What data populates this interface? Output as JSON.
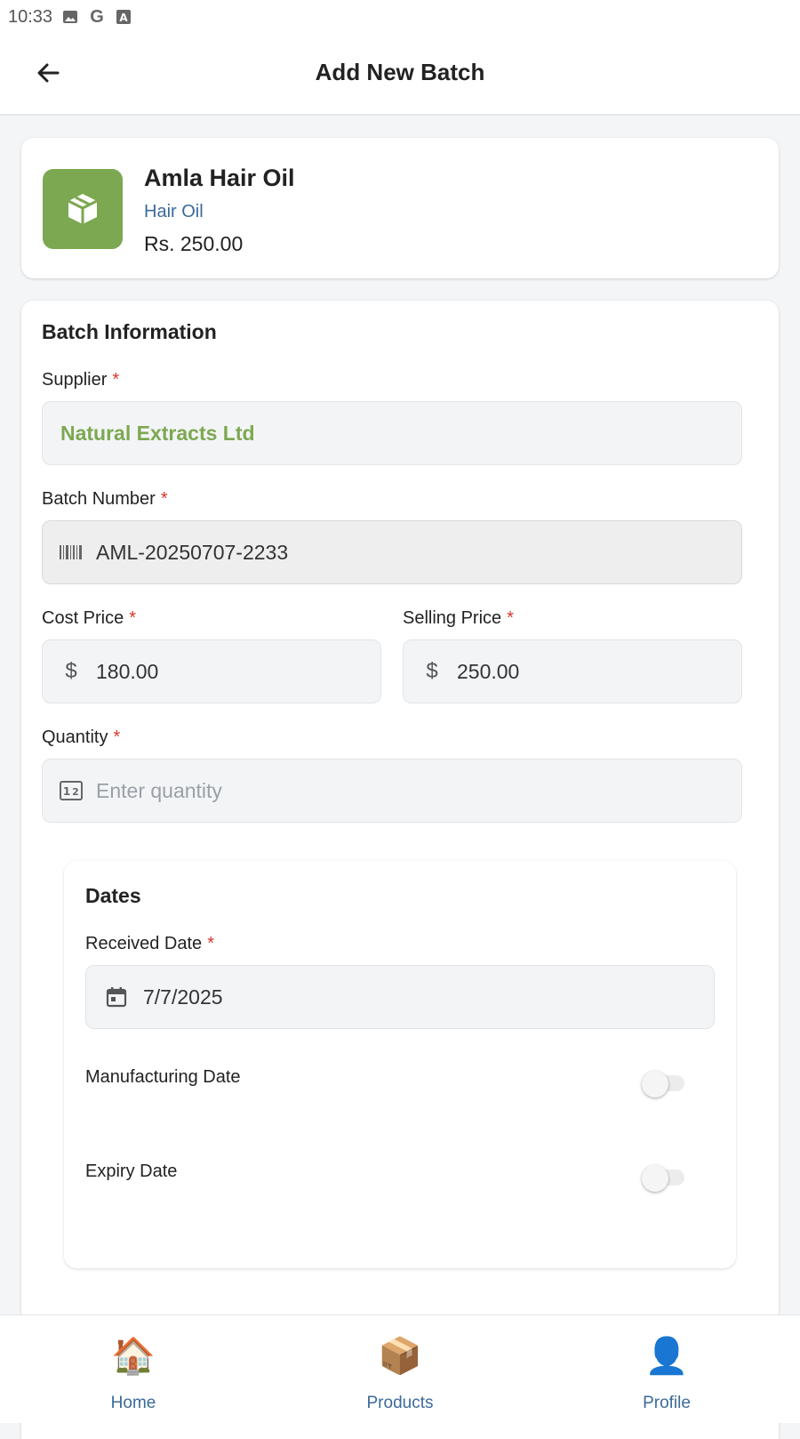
{
  "status_bar": {
    "time": "10:33",
    "icons": [
      "image-icon",
      "google-icon",
      "font-icon"
    ]
  },
  "app_bar": {
    "title": "Add New Batch",
    "back_icon": "arrow-back-icon"
  },
  "product": {
    "name": "Amla Hair Oil",
    "category": "Hair Oil",
    "price": "Rs. 250.00",
    "icon": "box-icon",
    "icon_bg": "#7ca851"
  },
  "batch_info": {
    "title": "Batch Information",
    "supplier": {
      "label": "Supplier",
      "required": "*",
      "value": "Natural Extracts Ltd"
    },
    "batch_number": {
      "label": "Batch Number",
      "required": "*",
      "value": "AML-20250707-2233",
      "icon": "barcode-icon"
    },
    "cost_price": {
      "label": "Cost Price",
      "required": "*",
      "value": "180.00",
      "icon": "dollar-icon"
    },
    "selling_price": {
      "label": "Selling Price",
      "required": "*",
      "value": "250.00",
      "icon": "dollar-icon"
    },
    "quantity": {
      "label": "Quantity",
      "required": "*",
      "placeholder": "Enter quantity",
      "value": "",
      "icon": "numbers-icon"
    }
  },
  "dates": {
    "title": "Dates",
    "received": {
      "label": "Received Date",
      "required": "*",
      "value": "7/7/2025",
      "icon": "calendar-icon"
    },
    "manufacturing": {
      "label": "Manufacturing Date",
      "enabled": false
    },
    "expiry": {
      "label": "Expiry Date",
      "enabled": false
    }
  },
  "bottom_nav": [
    {
      "label": "Home",
      "icon": "🏠"
    },
    {
      "label": "Products",
      "icon": "📦"
    },
    {
      "label": "Profile",
      "icon": "👤"
    }
  ],
  "colors": {
    "accent": "#7ca851",
    "link": "#3b6a9b",
    "required": "#d9362b"
  }
}
